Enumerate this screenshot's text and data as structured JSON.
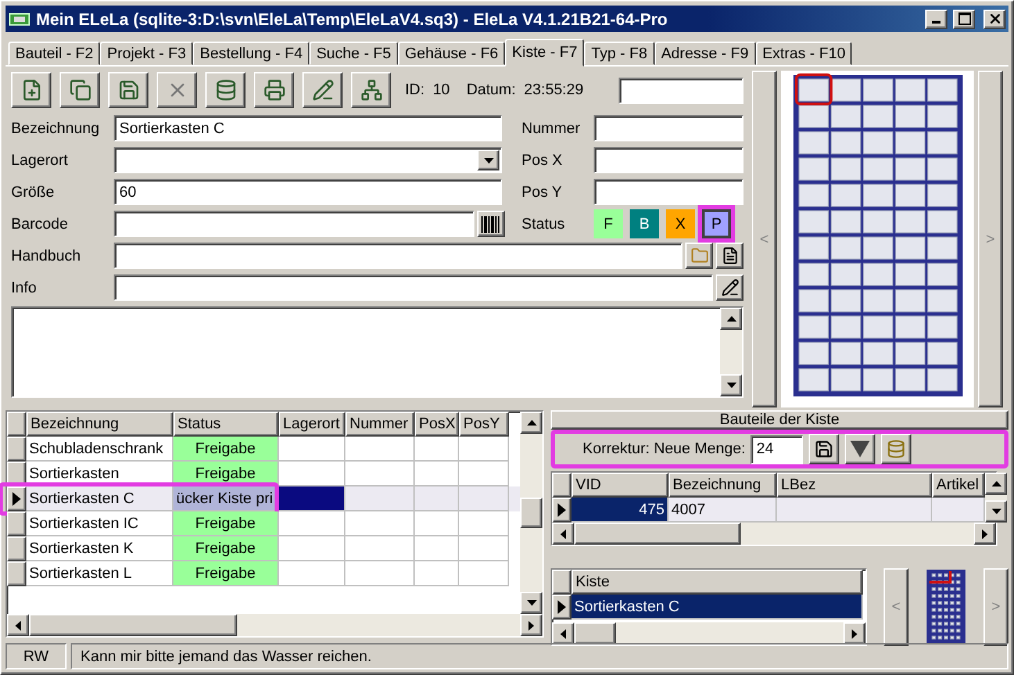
{
  "window": {
    "title": "Mein ELeLa (sqlite-3:D:\\svn\\EleLa\\Temp\\EleLaV4.sq3) - EleLa V4.1.21B21-64-Pro"
  },
  "tabs": [
    {
      "label": "Bauteil - F2",
      "selected": false
    },
    {
      "label": "Projekt - F3",
      "selected": false
    },
    {
      "label": "Bestellung - F4",
      "selected": false
    },
    {
      "label": "Suche - F5",
      "selected": false
    },
    {
      "label": "Gehäuse - F6",
      "selected": false
    },
    {
      "label": "Kiste - F7",
      "selected": true
    },
    {
      "label": "Typ - F8",
      "selected": false
    },
    {
      "label": "Adresse - F9",
      "selected": false
    },
    {
      "label": "Extras - F10",
      "selected": false
    }
  ],
  "toolbar": {
    "id_label": "ID:",
    "id": "10",
    "date_label": "Datum:",
    "time": "23:55:29"
  },
  "form": {
    "left": [
      {
        "label": "Bezeichnung",
        "value": "Sortierkasten C",
        "kind": "text"
      },
      {
        "label": "Lagerort",
        "kind": "dropdown"
      },
      {
        "label": "Größe",
        "value": "60",
        "kind": "text"
      },
      {
        "label": "Barcode",
        "kind": "barcode"
      }
    ],
    "right": [
      {
        "label": "Nummer"
      },
      {
        "label": "Pos X"
      },
      {
        "label": "Pos Y"
      }
    ],
    "wide": [
      {
        "label": "Handbuch",
        "kind": "file"
      },
      {
        "label": "Info",
        "kind": "note"
      }
    ]
  },
  "status": {
    "label": "Status",
    "options": [
      {
        "label": "F",
        "color": "#99ff99",
        "selected": false,
        "highlighted": false
      },
      {
        "label": "B",
        "color": "#008080",
        "selected": false,
        "highlighted": false
      },
      {
        "label": "X",
        "color": "#ffa500",
        "selected": false,
        "highlighted": false
      },
      {
        "label": "P",
        "color": "#a0a0ff",
        "selected": true,
        "highlighted": true
      }
    ]
  },
  "picture_nav": {
    "prev": "<",
    "next": ">"
  },
  "box_table": {
    "columns": [
      "Bezeichnung",
      "Status",
      "Lagerort",
      "Nummer",
      "PosX",
      "PosY"
    ],
    "rows": [
      {
        "name": "Schubladenschrank",
        "status": "Freigabe",
        "selected": false,
        "highlighted": false
      },
      {
        "name": "Sortierkasten",
        "status": "Freigabe",
        "selected": false,
        "highlighted": false
      },
      {
        "name": "Sortierkasten C",
        "status": "ücker Kiste pri",
        "selected": true,
        "highlighted": true
      },
      {
        "name": "Sortierkasten IC",
        "status": "Freigabe",
        "selected": false,
        "highlighted": false
      },
      {
        "name": "Sortierkasten K",
        "status": "Freigabe",
        "selected": false,
        "highlighted": false
      },
      {
        "name": "Sortierkasten L",
        "status": "Freigabe",
        "selected": false,
        "highlighted": false
      }
    ]
  },
  "parts_panel": {
    "title": "Bauteile der Kiste",
    "correction": {
      "label": "Korrektur: Neue Menge:",
      "value": "24",
      "highlighted": true
    },
    "columns": [
      "VID",
      "Bezeichnung",
      "LBez",
      "Artikel"
    ],
    "rows": [
      {
        "vid": "475",
        "name": "4007",
        "selected": true
      }
    ]
  },
  "kiste_table": {
    "column": "Kiste",
    "rows": [
      {
        "name": "Sortierkasten C",
        "selected": true
      }
    ]
  },
  "kiste_nav": {
    "prev": "<",
    "next": ">"
  },
  "status_bar": {
    "mode": "RW",
    "message": "Kann mir bitte jemand das Wasser reichen."
  }
}
